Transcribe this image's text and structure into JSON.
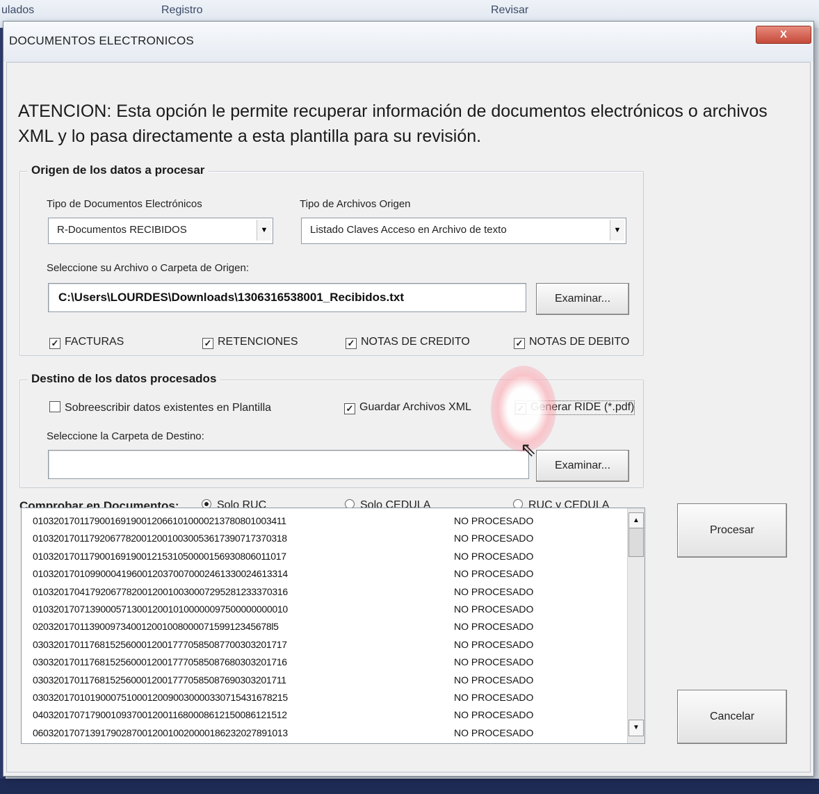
{
  "background": {
    "tabs": [
      "ulados",
      "Registro",
      "Revisar"
    ]
  },
  "dialog": {
    "title": "DOCUMENTOS ELECTRONICOS",
    "close_label": "X",
    "notice": "ATENCION: Esta opción le permite recuperar información de documentos electrónicos o archivos XML y lo pasa directamente a esta plantilla para su revisión."
  },
  "origin": {
    "legend": "Origen de los datos a procesar",
    "doc_type_label": "Tipo de Documentos Electrónicos",
    "doc_type_value": "R-Documentos RECIBIDOS",
    "file_type_label": "Tipo de Archivos Origen",
    "file_type_value": "Listado Claves Acceso en Archivo de texto",
    "path_label": "Seleccione su Archivo o Carpeta de Origen:",
    "path_value": "C:\\Users\\LOURDES\\Downloads\\1306316538001_Recibidos.txt",
    "browse_label": "Examinar...",
    "checkboxes": [
      {
        "label": "FACTURAS",
        "checked": true
      },
      {
        "label": "RETENCIONES",
        "checked": true
      },
      {
        "label": "NOTAS DE CREDITO",
        "checked": true
      },
      {
        "label": "NOTAS DE DEBITO",
        "checked": true
      }
    ]
  },
  "destination": {
    "legend": "Destino de los datos procesados",
    "overwrite_label": "Sobreescribir datos existentes en Plantilla",
    "overwrite_checked": false,
    "save_xml_label": "Guardar Archivos XML",
    "save_xml_checked": true,
    "ride_label": "Generar RIDE (*.pdf)",
    "ride_checked": true,
    "folder_label": "Seleccione la Carpeta de Destino:",
    "folder_value": "",
    "browse_label": "Examinar..."
  },
  "check": {
    "label": "Comprobar en Documentos:",
    "options": [
      {
        "label": "Solo RUC",
        "selected": true
      },
      {
        "label": "Solo CEDULA",
        "selected": false
      },
      {
        "label": "RUC y CEDULA",
        "selected": false
      }
    ]
  },
  "list": {
    "rows": [
      {
        "key": "0103201701179001691900120661010000213780801003411",
        "status": "NO PROCESADO"
      },
      {
        "key": "0103201701179206778200120010030053617390717370318",
        "status": "NO PROCESADO"
      },
      {
        "key": "0103201701179001691900121531050000156930806011017",
        "status": "NO PROCESADO"
      },
      {
        "key": "0103201701099000419600120370070002461330024613314",
        "status": "NO PROCESADO"
      },
      {
        "key": "0103201704179206778200120010030007295281233370316",
        "status": "NO PROCESADO"
      },
      {
        "key": "0103201707139000571300120010100000097500000000010",
        "status": "NO PROCESADO"
      },
      {
        "key": "0203201701139009734001200100800007159912345678l5",
        "status": "NO PROCESADO"
      },
      {
        "key": "0303201701176815256000120017770585087700303201717",
        "status": "NO PROCESADO"
      },
      {
        "key": "0303201701176815256000120017770585087680303201716",
        "status": "NO PROCESADO"
      },
      {
        "key": "0303201701176815256000120017770585087690303201711",
        "status": "NO PROCESADO"
      },
      {
        "key": "0303201701019000751000120090030000330715431678215",
        "status": "NO PROCESADO"
      },
      {
        "key": "0403201707179001093700120011680008612150086121512",
        "status": "NO PROCESADO"
      },
      {
        "key": "0603201707139179028700120010020000186232027891013",
        "status": "NO PROCESADO"
      }
    ]
  },
  "actions": {
    "process_label": "Procesar",
    "cancel_label": "Cancelar"
  }
}
